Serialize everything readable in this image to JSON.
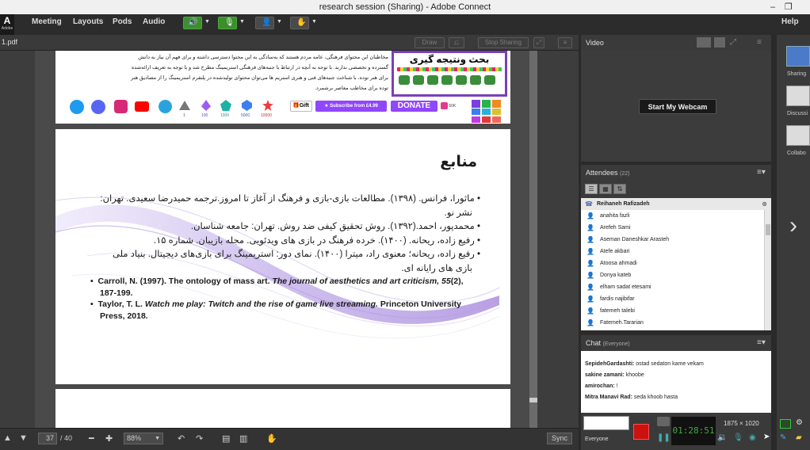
{
  "window": {
    "title": "research session (Sharing) - Adobe Connect"
  },
  "menu": {
    "items": [
      "Meeting",
      "Layouts",
      "Pods",
      "Audio"
    ],
    "help": "Help"
  },
  "share_pod": {
    "file_name": "1.pdf",
    "controls": {
      "draw": "Draw",
      "stop_sharing": "Stop Sharing"
    }
  },
  "slide_top": {
    "heading": "بحث ونتیجه گیری",
    "paragraph_lines": [
      "مخاطبان این  محتوای فرهنگی، عامه مردم هستند که به‌سادگی به این محتوا دسترسی داشته و برای فهم آن نیاز به دانش",
      "گسترده و تخصصی ندارند. با توجه به آنچه در ارتباط با جنبه‌های فرهنگی استریمینگ مطرح شد و با توجه به تعریف ارائه‌شده",
      "برای هنر توده، با شناخت جنبه‌های فنی و هنری استریم ها می‌توان محتوای تولیدشده در پلتفرم استریمینگ را از مصادیق هنر",
      "توده برای مخاطب معاصر برشمرد."
    ],
    "gift_label": "Gift",
    "subscribe_label": "Subscribe from £4.99",
    "donate_label": "DONATE",
    "bits_label": "60K",
    "tiers": [
      "1",
      "100",
      "1000",
      "5000",
      "10000"
    ]
  },
  "slide_main": {
    "title": "منابع",
    "fa_refs": [
      [
        "ماثورا، فرانس. (۱۳۹۸). مطالعات بازی-بازی و فرهنگ از آغاز تا امروز.ترجمه حمیدرضا سعیدی. تهران:",
        "نشر نو."
      ],
      [
        "محمدپور، احمد.(۱۳۹۲). روش تحقیق کیفی ضد روش. تهران: جامعه شناسان."
      ],
      [
        "رفیع زاده، ریحانه. (۱۴۰۰). خرده فرهنگ در بازی های ویدئویی. مجله بازیبان. شماره ۱۵."
      ],
      [
        "رفیع زاده، ریحانه؛ معنوی راد، میترا (۱۴۰۰). نمای دور: استریمینگ برای بازی‌های دیجیتال. بنیاد ملی",
        "بازی های رایانه ای."
      ]
    ],
    "en_ref_1": {
      "authors": "Carroll, N. (1997). The ontology of mass art. ",
      "journal": "The journal of aesthetics and art criticism, 55",
      "rest": "(2),",
      "line2": "187-199."
    },
    "en_ref_2": {
      "authors": "Taylor, T. L. ",
      "book": "Watch me play: Twitch and the rise of game live streaming.",
      "rest": " Princeton University",
      "line2": "Press, 2018."
    }
  },
  "bottom_bar": {
    "page_current": "37",
    "page_total": "/ 40",
    "zoom": "88%",
    "sync_label": "Sync"
  },
  "video_pod": {
    "title": "Video",
    "webcam_button": "Start My Webcam"
  },
  "attendees_pod": {
    "title": "Attendees",
    "count": "(22)",
    "host": "Reihaneh Rafizadeh",
    "list": [
      "anahita fazli",
      "Arefeh Sami",
      "Aseman Daneshkar Arasteh",
      "Atefe akbari",
      "Atoosa ahmadi",
      "Donya kateb",
      "elham sadat etesami",
      "fardis najibifar",
      "fatemeh talebi",
      "Fatemeh.Tararian"
    ]
  },
  "chat_pod": {
    "title": "Chat",
    "scope": "(Everyone)",
    "messages": [
      {
        "sender": "SepidehGardashti:",
        "text": "ostad sedaton kame vekam"
      },
      {
        "sender": "sakine zamani:",
        "text": "khoobe"
      },
      {
        "sender": "amirochan:",
        "text": "!"
      },
      {
        "sender": "Mitra Manavi Rad:",
        "text": "seda khoob hasta"
      }
    ],
    "recipient": "Everyone",
    "timer": "01:28:51",
    "resolution": "1875 × 1020"
  },
  "rail": {
    "items": [
      "Sharing",
      "Discussi",
      "Collabo"
    ]
  },
  "colors": {
    "accent_green": "#3d8f2d",
    "record_red": "#cc1111",
    "donate_purple": "#9146ff"
  }
}
